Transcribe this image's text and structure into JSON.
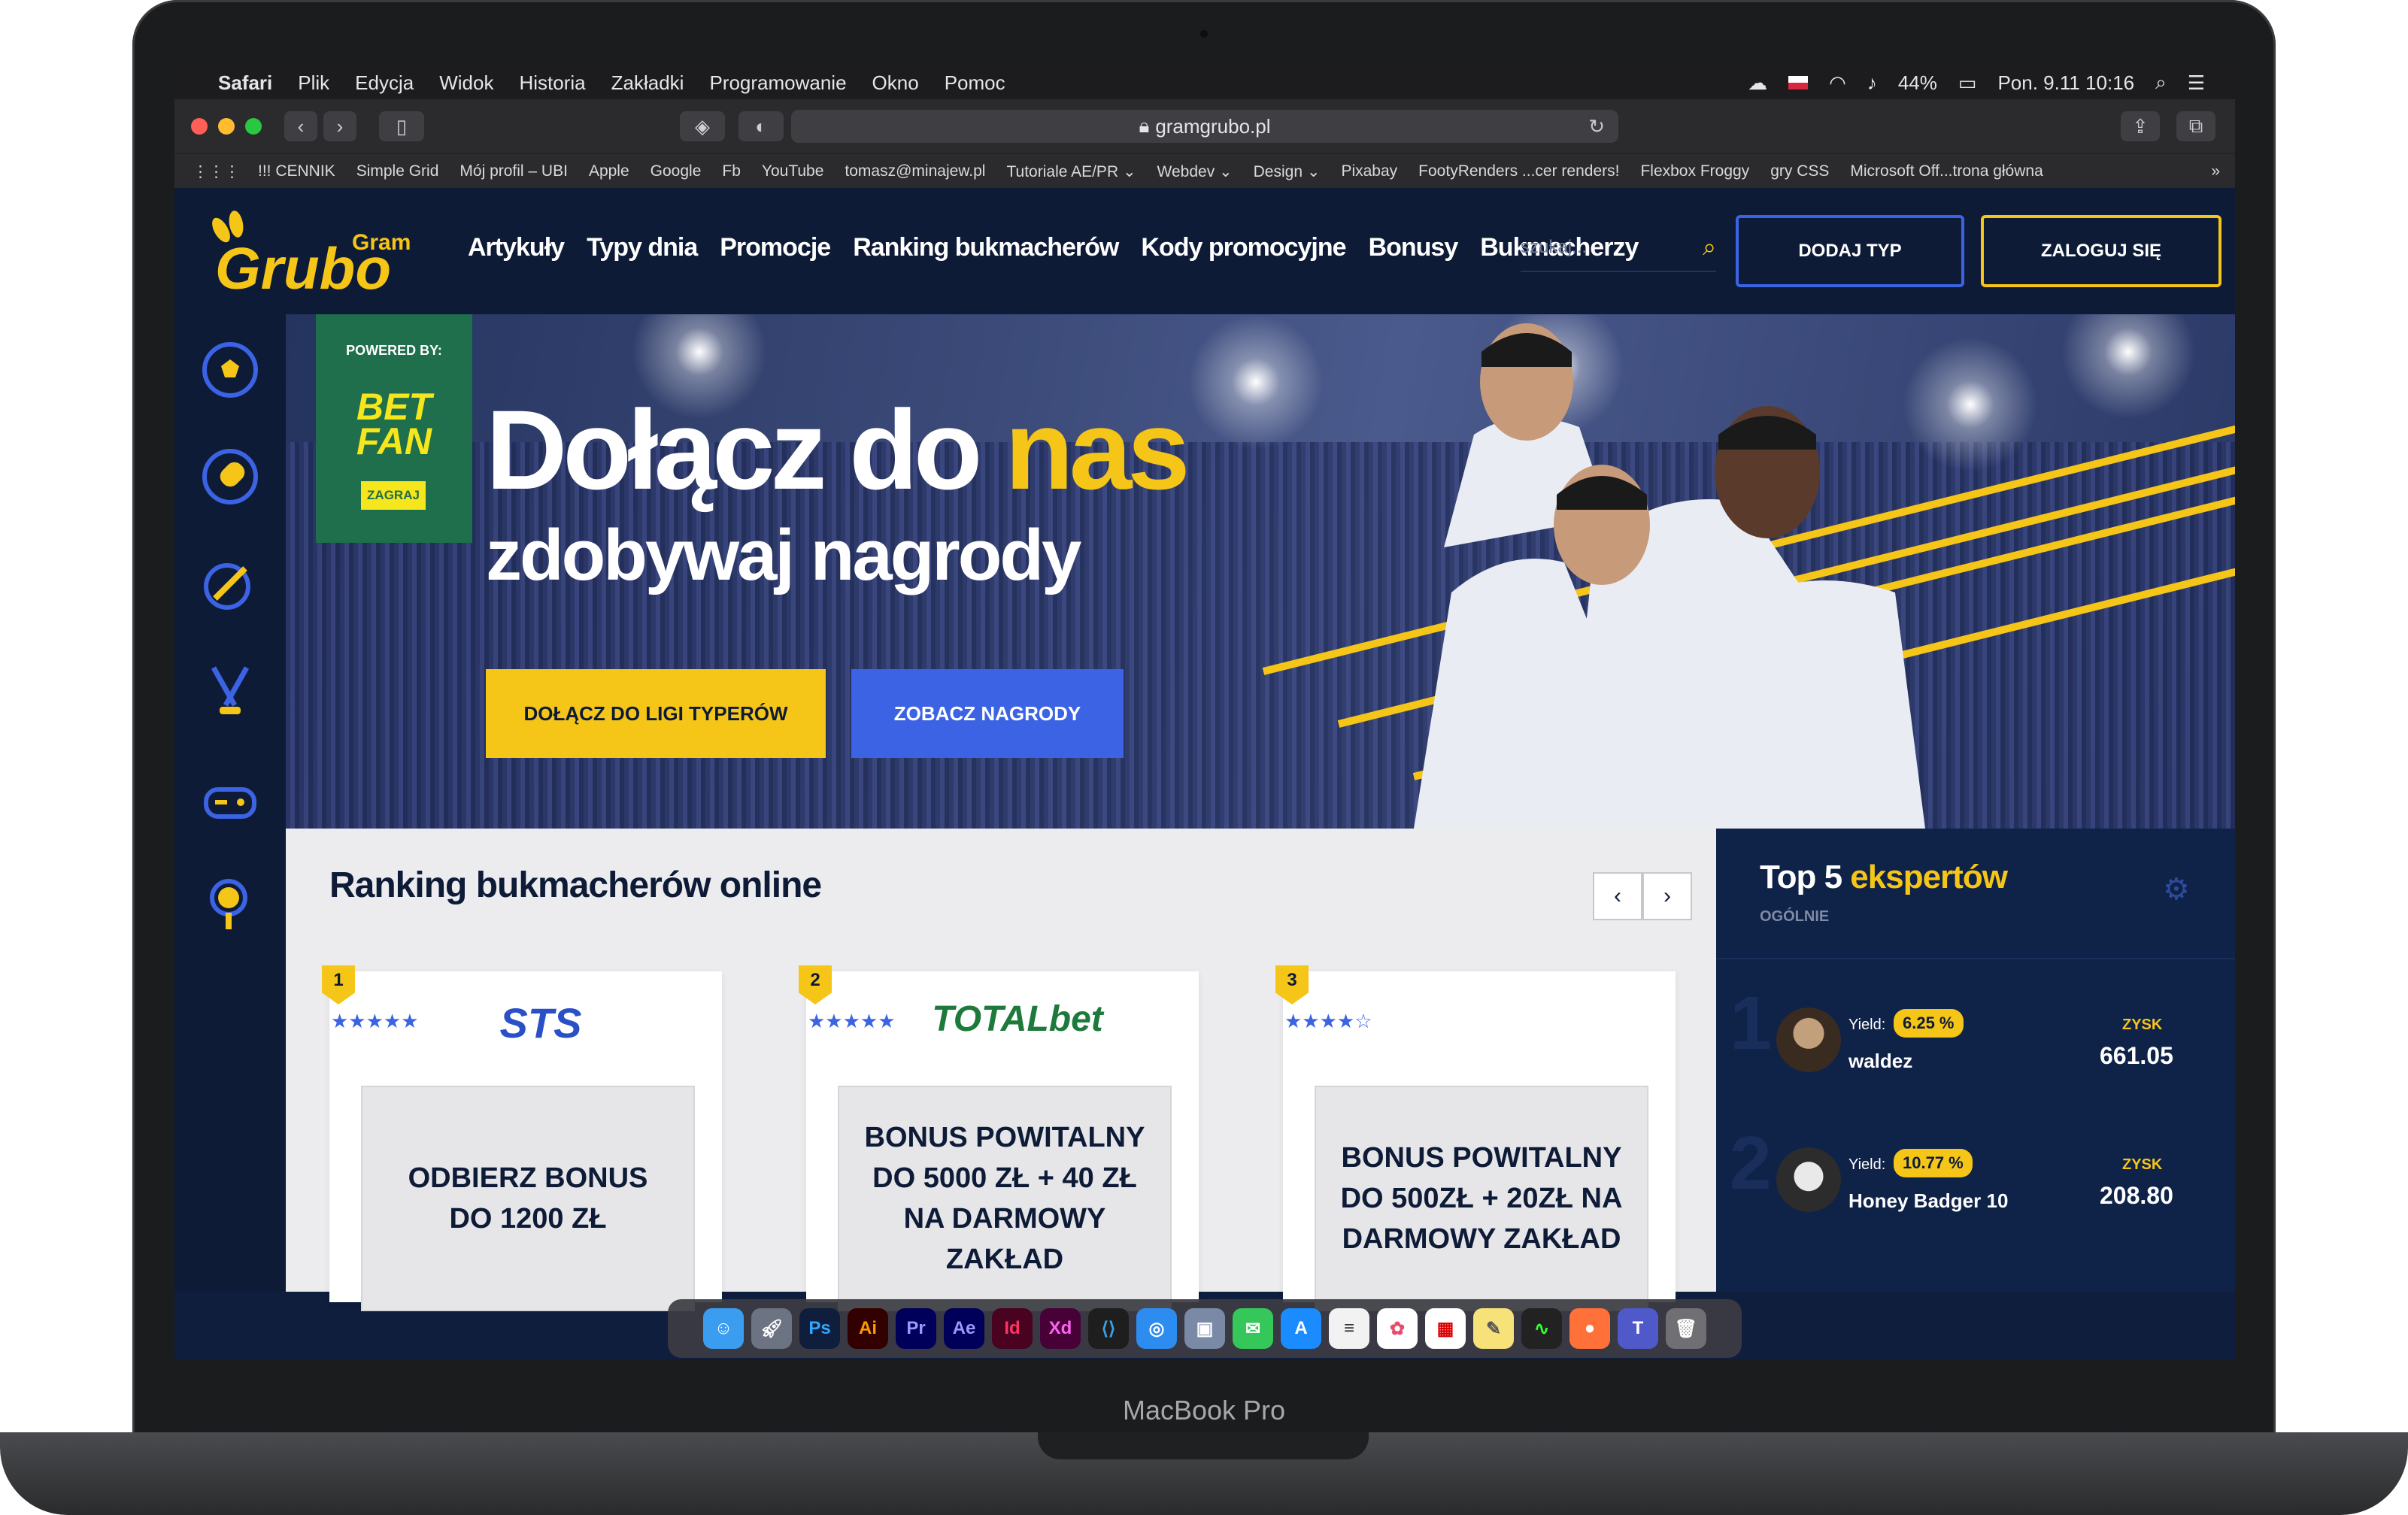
{
  "mac": {
    "model_label": "MacBook Pro",
    "menubar": {
      "apple": "",
      "app": "Safari",
      "items": [
        "Plik",
        "Edycja",
        "Widok",
        "Historia",
        "Zakładki",
        "Programowanie",
        "Okno",
        "Pomoc"
      ],
      "battery": "44%",
      "datetime": "Pon. 9.11  10:16"
    }
  },
  "browser": {
    "url": "gramgrubo.pl",
    "bookmarks": [
      "!!! CENNIK",
      "Simple Grid",
      "Mój profil – UBI",
      "Apple",
      "Google",
      "Fb",
      "YouTube",
      "tomasz@minajew.pl",
      "Tutoriale AE/PR ⌄",
      "Webdev ⌄",
      "Design ⌄",
      "Pixabay",
      "FootyRenders ...cer renders!",
      "Flexbox Froggy",
      "gry CSS",
      "Microsoft Off...trona główna"
    ]
  },
  "site": {
    "logo": {
      "grubo": "Grubo",
      "gram": "Gram"
    },
    "nav": [
      "Artykuły",
      "Typy dnia",
      "Promocje",
      "Ranking bukmacherów",
      "Kody promocyjne",
      "Bonusy",
      "Bukmacherzy"
    ],
    "search_placeholder": "szukaj...",
    "add_tip": "DODAJ TYP",
    "login": "ZALOGUJ SIĘ",
    "hero": {
      "powered_by": "POWERED BY:",
      "sponsor": "BET FAN",
      "sponsor_cta": "ZAGRAJ",
      "headline_white": "Dołącz do",
      "headline_accent": "nas",
      "subheadline": "zdobywaj nagrody",
      "cta_primary": "DOŁĄCZ DO LIGI TYPERÓW",
      "cta_secondary": "ZOBACZ NAGRODY"
    },
    "ranking": {
      "title": "Ranking bukmacherów online",
      "cards": [
        {
          "rank": "1",
          "brand": "STS",
          "bonus": "ODBIERZ BONUS DO 1200 ZŁ",
          "stars": "★★★★★"
        },
        {
          "rank": "2",
          "brand": "TOTALbet",
          "bonus": "BONUS POWITALNY DO 5000 ZŁ + 40 ZŁ NA DARMOWY ZAKŁAD",
          "stars": "★★★★★"
        },
        {
          "rank": "3",
          "brand": "",
          "bonus": "BONUS POWITALNY DO 500ZŁ + 20ZŁ NA DARMOWY ZAKŁAD",
          "stars": "★★★★☆"
        }
      ]
    },
    "top5": {
      "title_white": "Top 5",
      "title_accent": "ekspertów",
      "subtitle": "OGÓLNIE",
      "experts": [
        {
          "rank": "1",
          "yield_label": "Yield:",
          "yield": "6.25 %",
          "name": "waldez",
          "profit_label": "ZYSK",
          "profit": "661.05"
        },
        {
          "rank": "2",
          "yield_label": "Yield:",
          "yield": "10.77 %",
          "name": "Honey Badger 10",
          "profit_label": "ZYSK",
          "profit": "208.80"
        }
      ]
    }
  },
  "dock": [
    "Ps",
    "Ai",
    "Pr",
    "Ae",
    "Id",
    "Xd"
  ],
  "colors": {
    "navy": "#0e1b37",
    "yellow": "#f5c518",
    "blue": "#3b63e3"
  }
}
